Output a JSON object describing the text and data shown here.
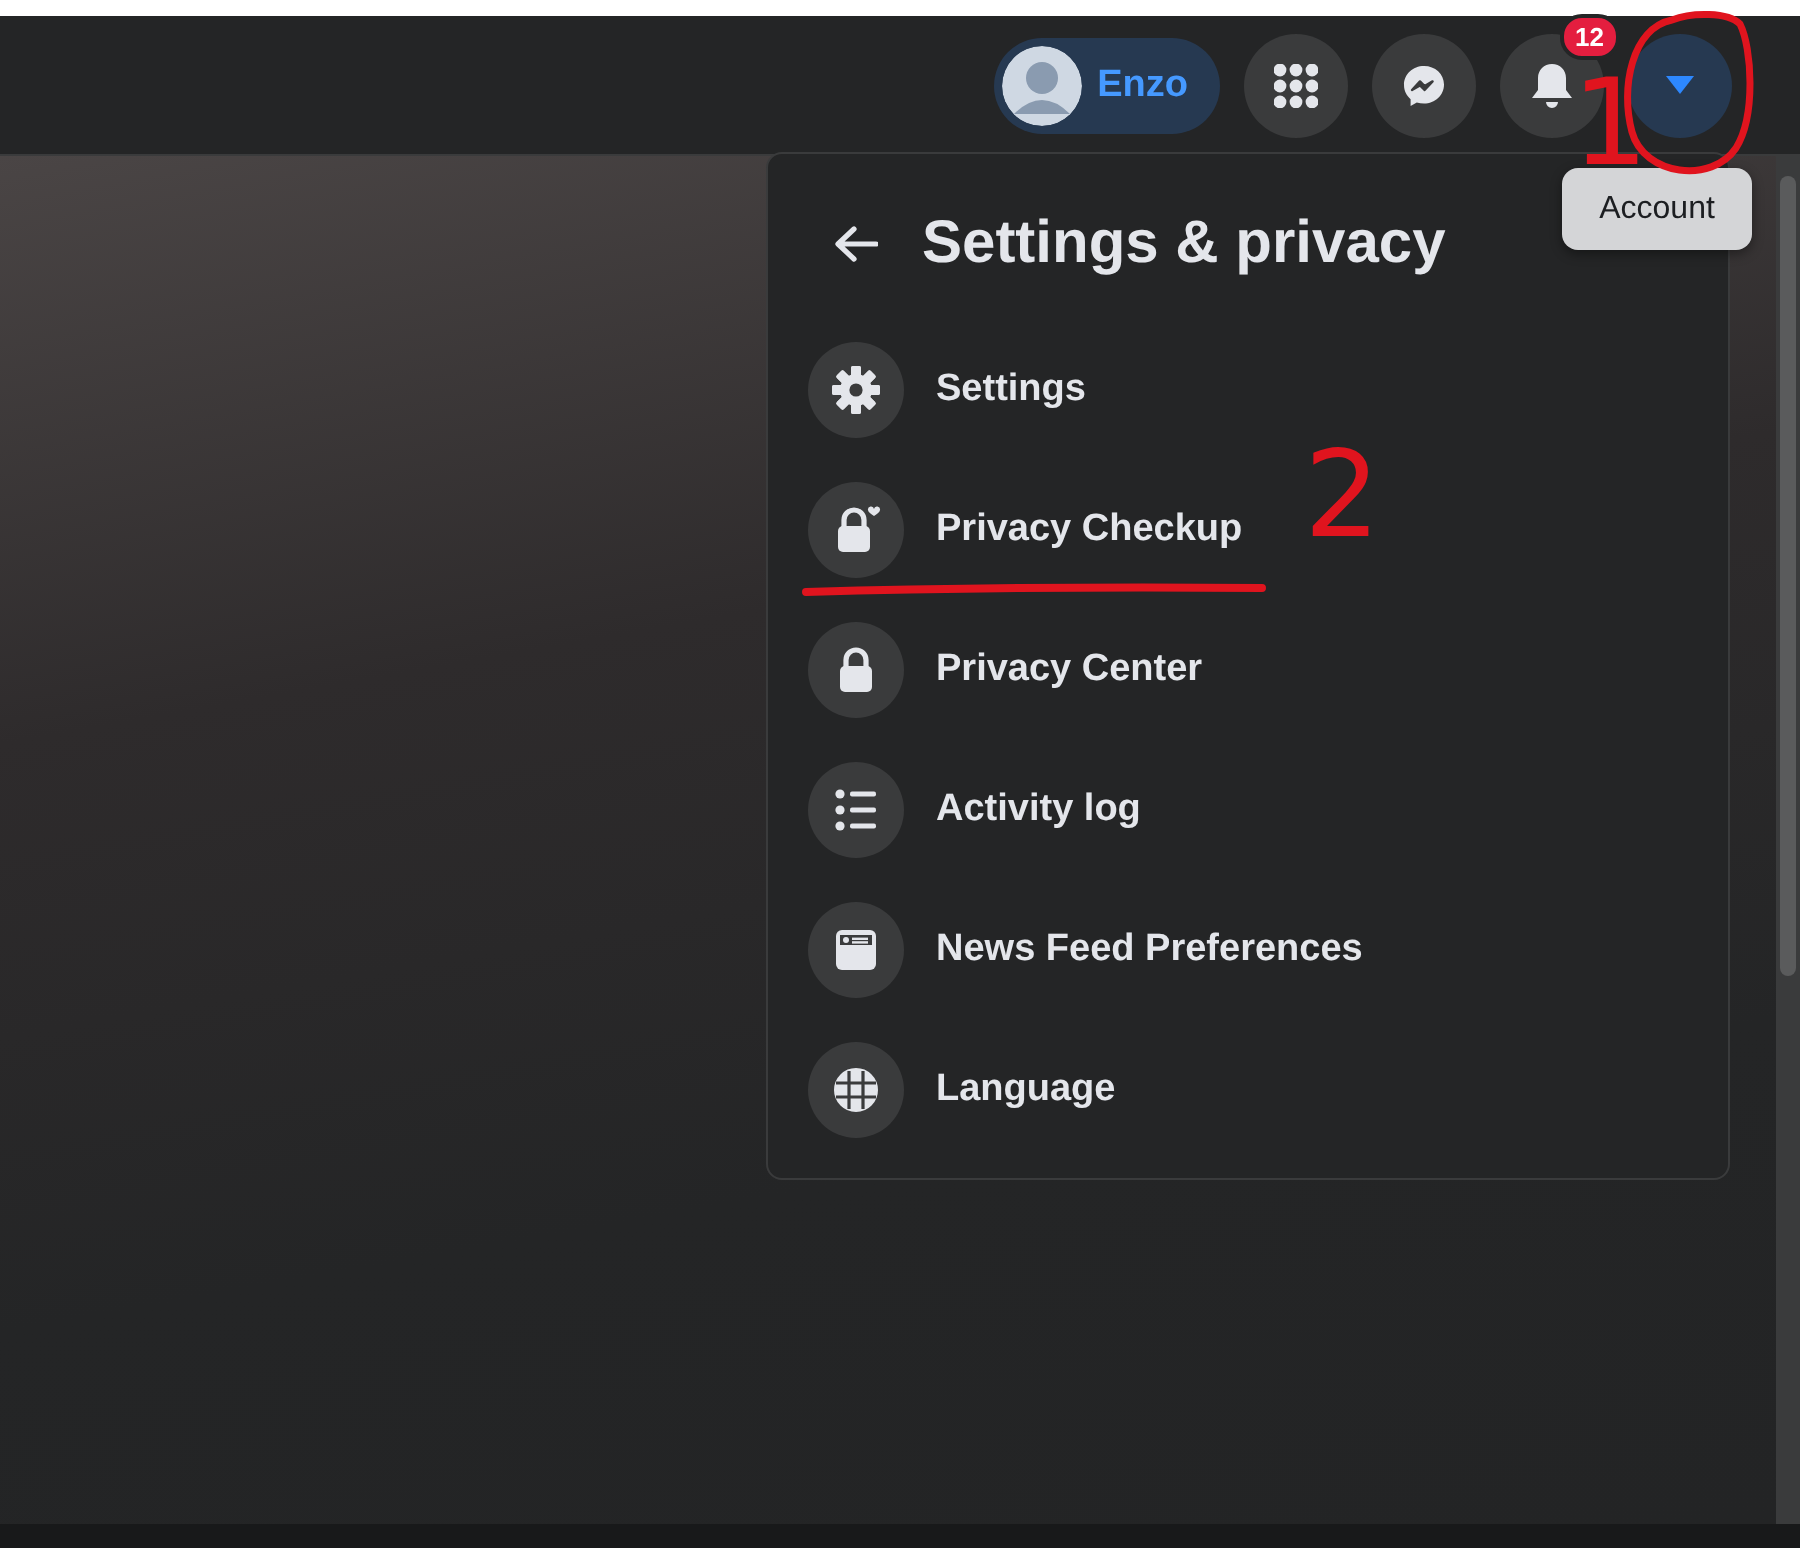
{
  "topbar": {
    "profile": {
      "name": "Enzo"
    },
    "buttons": [
      {
        "kind": "apps",
        "selected": false
      },
      {
        "kind": "messenger",
        "selected": false
      },
      {
        "kind": "notifications",
        "selected": false,
        "badge": "12"
      },
      {
        "kind": "account",
        "selected": true
      }
    ]
  },
  "tooltip": "Account",
  "menu": {
    "title": "Settings & privacy",
    "items": [
      {
        "label": "Settings",
        "kind": "gear"
      },
      {
        "label": "Privacy Checkup",
        "kind": "lock-heart"
      },
      {
        "label": "Privacy Center",
        "kind": "lock"
      },
      {
        "label": "Activity log",
        "kind": "list"
      },
      {
        "label": "News Feed Preferences",
        "kind": "feed"
      },
      {
        "label": "Language",
        "kind": "globe"
      }
    ]
  },
  "annotations": [
    {
      "kind": "circle"
    },
    {
      "kind": "number",
      "text": "1"
    },
    {
      "kind": "underline"
    },
    {
      "kind": "number",
      "text": "2"
    }
  ]
}
